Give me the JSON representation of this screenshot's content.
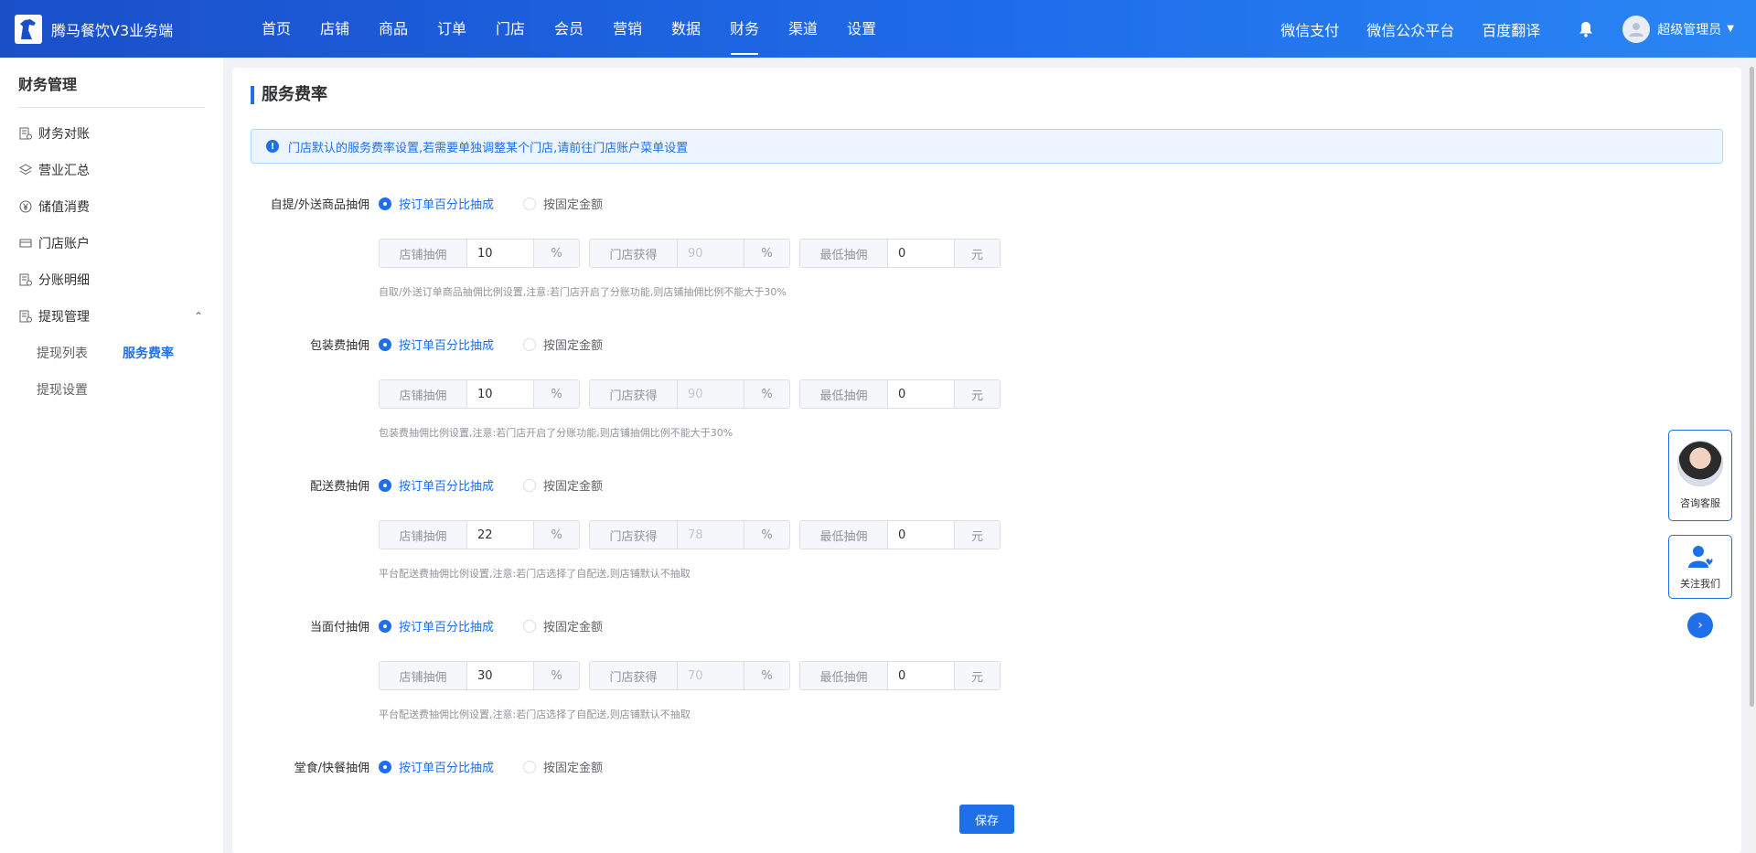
{
  "header": {
    "app_name": "腾马餐饮V3业务端",
    "nav": [
      "首页",
      "店铺",
      "商品",
      "订单",
      "门店",
      "会员",
      "营销",
      "数据",
      "财务",
      "渠道",
      "设置"
    ],
    "active_nav": "财务",
    "links": [
      "微信支付",
      "微信公众平台",
      "百度翻译"
    ],
    "user_name": "超级管理员"
  },
  "sidebar": {
    "title": "财务管理",
    "items": [
      {
        "label": "财务对账",
        "icon": "ledger-icon"
      },
      {
        "label": "营业汇总",
        "icon": "layers-icon"
      },
      {
        "label": "储值消费",
        "icon": "yen-circle-icon"
      },
      {
        "label": "门店账户",
        "icon": "card-icon"
      },
      {
        "label": "分账明细",
        "icon": "ledger-icon"
      },
      {
        "label": "提现管理",
        "icon": "ledger-icon"
      }
    ],
    "sub_items": [
      "提现列表",
      "服务费率",
      "提现设置"
    ],
    "active_sub": "服务费率"
  },
  "main": {
    "title": "服务费率",
    "notice": "门店默认的服务费率设置,若需要单独调整某个门店,请前往门店账户菜单设置",
    "radio_options": [
      "按订单百分比抽成",
      "按固定金额"
    ],
    "field_labels": {
      "store": "店铺抽佣",
      "shop": "门店获得",
      "min": "最低抽佣",
      "percent": "%",
      "yuan": "元"
    },
    "sections": [
      {
        "label": "自提/外送商品抽佣",
        "store": "10",
        "shop": "90",
        "min": "0",
        "hint": "自取/外送订单商品抽佣比例设置,注意:若门店开启了分账功能,则店铺抽佣比例不能大于30%"
      },
      {
        "label": "包装费抽佣",
        "store": "10",
        "shop": "90",
        "min": "0",
        "hint": "包装费抽佣比例设置,注意:若门店开启了分账功能,则店铺抽佣比例不能大于30%"
      },
      {
        "label": "配送费抽佣",
        "store": "22",
        "shop": "78",
        "min": "0",
        "hint": "平台配送费抽佣比例设置,注意:若门店选择了自配送,则店铺默认不抽取"
      },
      {
        "label": "当面付抽佣",
        "store": "30",
        "shop": "70",
        "min": "0",
        "hint": "平台配送费抽佣比例设置,注意:若门店选择了自配送,则店铺默认不抽取"
      },
      {
        "label": "堂食/快餐抽佣"
      }
    ],
    "save_label": "保存"
  },
  "float": {
    "service_label": "咨询客服",
    "follow_label": "关注我们"
  },
  "colors": {
    "primary": "#1f6feb",
    "header_start": "#1a4fc8",
    "header_end": "#2a86f3"
  }
}
